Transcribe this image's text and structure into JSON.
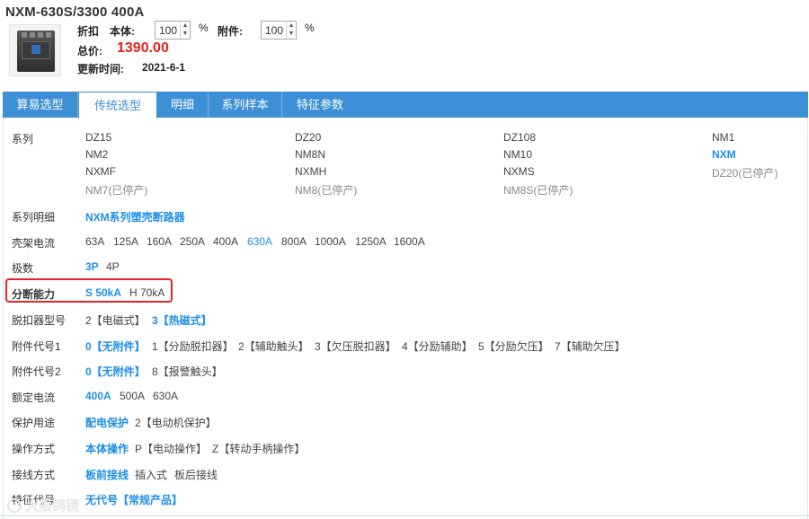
{
  "header": {
    "title": "NXM-630S/3300 400A",
    "discount_label": "折扣",
    "body_label": "本体:",
    "body_value": "100",
    "percent": "%",
    "accessory_label": "附件:",
    "accessory_value": "100",
    "total_label": "总价:",
    "total_price": "1390.00",
    "update_label": "更新时间:",
    "update_date": "2021-6-1"
  },
  "tabs": [
    "算易选型",
    "传统选型",
    "明细",
    "系列样本",
    "特征参数"
  ],
  "series": {
    "label": "系列",
    "items": [
      "DZ15",
      "DZ20",
      "DZ108",
      "NM1",
      "NM2",
      "NM8N",
      "NM10",
      "NXM",
      "NXMF",
      "NXMH",
      "NXMS",
      "DZ20(已停产)",
      "NM7(已停产)",
      "NM8(已停产)",
      "NM8S(已停产)"
    ]
  },
  "series_detail": {
    "label": "系列明细",
    "value": "NXM系列塑壳断路器"
  },
  "frame_current": {
    "label": "壳架电流",
    "options": [
      "63A",
      "125A",
      "160A",
      "250A",
      "400A",
      "630A",
      "800A",
      "1000A",
      "1250A",
      "1600A"
    ]
  },
  "poles": {
    "label": "极数",
    "options": [
      "3P",
      "4P"
    ]
  },
  "breaking_capacity": {
    "label": "分断能力",
    "options": [
      "S 50kA",
      "H 70kA"
    ]
  },
  "release_type": {
    "label": "脱扣器型号",
    "options": [
      "2【电磁式】",
      "3【热磁式】"
    ]
  },
  "accessory_code1": {
    "label": "附件代号1",
    "options": [
      "0【无附件】",
      "1【分励脱扣器】",
      "2【辅助触头】",
      "3【欠压脱扣器】",
      "4【分励辅助】",
      "5【分励欠压】",
      "7【辅助欠压】"
    ]
  },
  "accessory_code2": {
    "label": "附件代号2",
    "options": [
      "0【无附件】",
      "8【报警触头】"
    ]
  },
  "rated_current": {
    "label": "额定电流",
    "options": [
      "400A",
      "500A",
      "630A"
    ]
  },
  "protection": {
    "label": "保护用途",
    "options": [
      "配电保护",
      "2【电动机保护】"
    ]
  },
  "operation": {
    "label": "操作方式",
    "options": [
      "本体操作",
      "P【电动操作】",
      "Z【转动手柄操作】"
    ]
  },
  "wiring": {
    "label": "接线方式",
    "options": [
      "板前接线",
      "插入式",
      "板后接线"
    ]
  },
  "special": {
    "label": "特征代号",
    "options": [
      "无代号【常规产品】"
    ]
  },
  "watermark": "大般鸽镜",
  "colors": {
    "accent": "#3d8fd6",
    "selected": "#1f8ee8",
    "price": "#e8211d",
    "highlight": "#e3242b"
  }
}
